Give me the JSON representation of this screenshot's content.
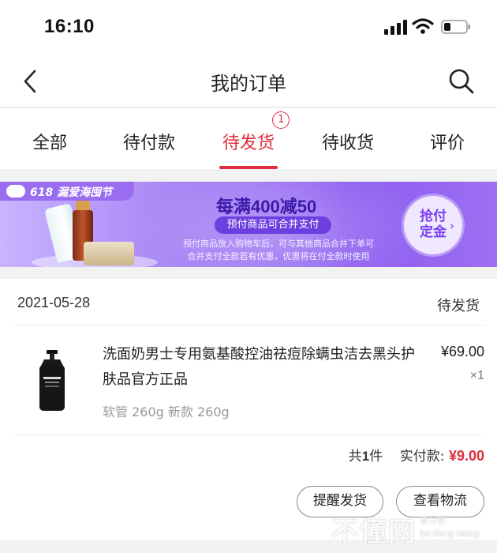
{
  "status_bar": {
    "time": "16:10"
  },
  "nav": {
    "title": "我的订单",
    "back_icon": "chevron-left-icon",
    "search_icon": "search-icon"
  },
  "tabs": [
    {
      "label": "全部",
      "active": false
    },
    {
      "label": "待付款",
      "active": false
    },
    {
      "label": "待发货",
      "active": true,
      "badge": "1"
    },
    {
      "label": "待收货",
      "active": false
    },
    {
      "label": "评价",
      "active": false
    }
  ],
  "banner": {
    "logo_text": "618 漏爱海囤节",
    "headline": "每满400减50",
    "pill": "预付商品可合并支付",
    "note_line1": "预付商品放入购物车后，可与其他商品合并下单可",
    "note_line2": "合并支付全款若有优惠，优惠将在付全款时使用",
    "cta": "抢付定金"
  },
  "order": {
    "date": "2021-05-28",
    "status": "待发货",
    "product": {
      "name": "洗面奶男士专用氨基酸控油祛痘除螨虫洁去黑头护肤品官方正品",
      "price": "¥69.00",
      "quantity": "×1",
      "spec": "软管 260g 新款 260g"
    },
    "summary": {
      "count_prefix": "共",
      "count": "1",
      "count_suffix": "件",
      "paid_label": "实付款:",
      "paid_amount": "¥9.00"
    },
    "buttons": {
      "remind": "提醒发货",
      "track": "查看物流"
    }
  },
  "watermark": {
    "big": "不懂网",
    "small1": "曾分享",
    "small2": "bu dong wang"
  },
  "colors": {
    "accent": "#e02e3c",
    "banner_purple": "#8c5cf0",
    "divider": "#ececec"
  }
}
